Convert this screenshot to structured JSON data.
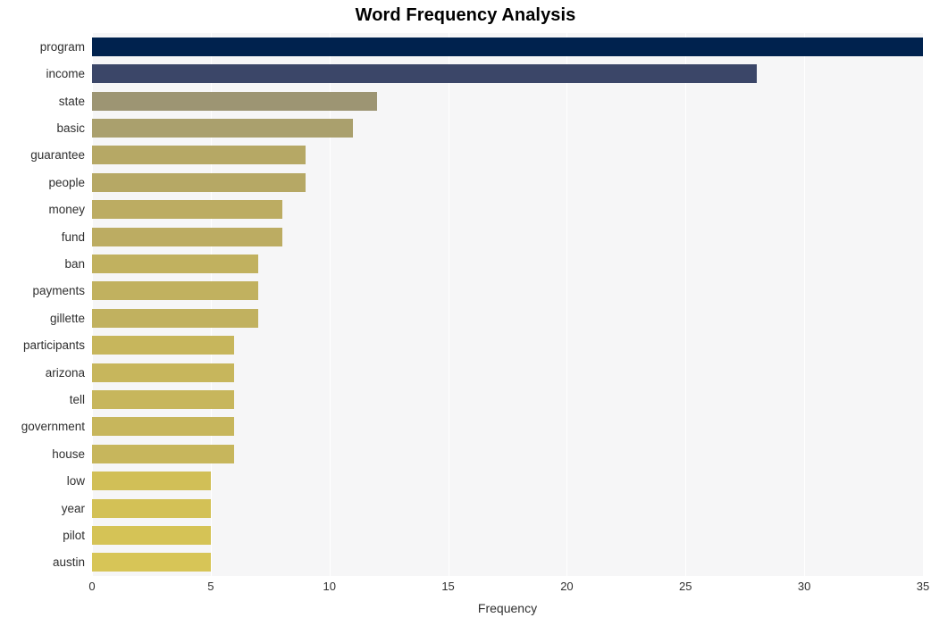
{
  "chart_data": {
    "type": "bar",
    "orientation": "horizontal",
    "title": "Word Frequency Analysis",
    "xlabel": "Frequency",
    "ylabel": "",
    "xlim": [
      0,
      35
    ],
    "ylim": null,
    "grid": true,
    "legend": null,
    "xticks": [
      0,
      5,
      10,
      15,
      20,
      25,
      30,
      35
    ],
    "xtick_labels": [
      "0",
      "5",
      "10",
      "15",
      "20",
      "25",
      "30",
      "35"
    ],
    "categories": [
      "program",
      "income",
      "state",
      "basic",
      "guarantee",
      "people",
      "money",
      "fund",
      "ban",
      "payments",
      "gillette",
      "participants",
      "arizona",
      "tell",
      "government",
      "house",
      "low",
      "year",
      "pilot",
      "austin"
    ],
    "values": [
      35,
      28,
      12,
      11,
      9,
      9,
      8,
      8,
      7,
      7,
      7,
      6,
      6,
      6,
      6,
      6,
      5,
      5,
      5,
      5
    ],
    "bar_colors": [
      "#00224e",
      "#3b4668",
      "#9d9573",
      "#aaa06d",
      "#b6a865",
      "#b6a865",
      "#bcac62",
      "#bcac62",
      "#c1b15f",
      "#c1b15f",
      "#c1b15f",
      "#c7b65c",
      "#c7b65c",
      "#c7b65c",
      "#c7b65c",
      "#c7b65c",
      "#d1bf57",
      "#d3c156",
      "#d5c356",
      "#d7c557"
    ],
    "plot_background": "#f6f6f7",
    "gridline_color": "#ffffff",
    "figure_background": "#ffffff"
  }
}
